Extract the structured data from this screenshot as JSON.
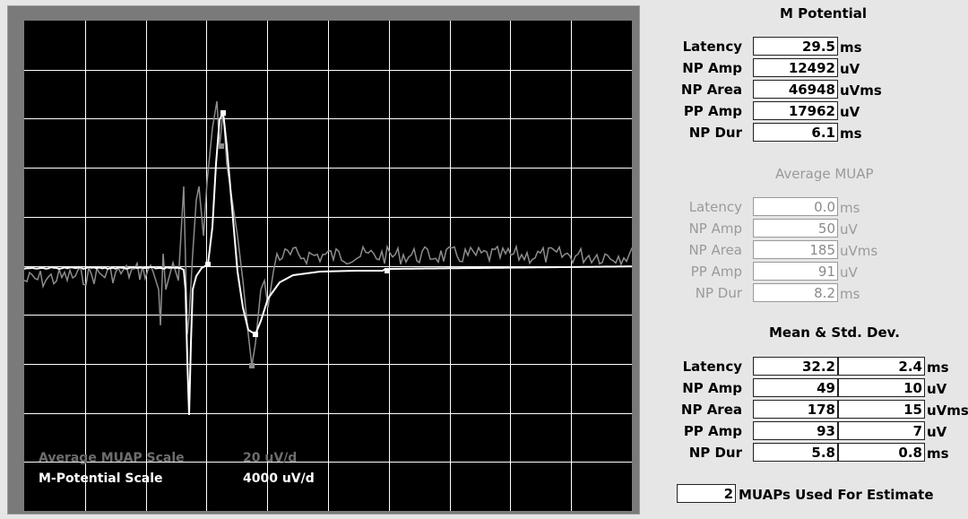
{
  "scope": {
    "avg_muap_scale_label": "Average MUAP Scale",
    "avg_muap_scale_value": "20 uV/d",
    "m_potential_scale_label": "M-Potential Scale",
    "m_potential_scale_value": "4000 uV/d"
  },
  "m_potential": {
    "title": "M Potential",
    "rows": [
      {
        "label": "Latency",
        "value": "29.5",
        "unit": "ms"
      },
      {
        "label": "NP Amp",
        "value": "12492",
        "unit": "uV"
      },
      {
        "label": "NP Area",
        "value": "46948",
        "unit": "uVms"
      },
      {
        "label": "PP Amp",
        "value": "17962",
        "unit": "uV"
      },
      {
        "label": "NP Dur",
        "value": "6.1",
        "unit": "ms"
      }
    ]
  },
  "average_muap": {
    "title": "Average MUAP",
    "rows": [
      {
        "label": "Latency",
        "value": "0.0",
        "unit": "ms"
      },
      {
        "label": "NP Amp",
        "value": "50",
        "unit": "uV"
      },
      {
        "label": "NP Area",
        "value": "185",
        "unit": "uVms"
      },
      {
        "label": "PP Amp",
        "value": "91",
        "unit": "uV"
      },
      {
        "label": "NP Dur",
        "value": "8.2",
        "unit": "ms"
      }
    ]
  },
  "mean_std": {
    "title": "Mean & Std. Dev.",
    "rows": [
      {
        "label": "Latency",
        "mean": "32.2",
        "std": "2.4",
        "unit": "ms"
      },
      {
        "label": "NP Amp",
        "mean": "49",
        "std": "10",
        "unit": "uV"
      },
      {
        "label": "NP Area",
        "mean": "178",
        "std": "15",
        "unit": "uVms"
      },
      {
        "label": "PP Amp",
        "mean": "93",
        "std": "7",
        "unit": "uV"
      },
      {
        "label": "NP Dur",
        "mean": "5.8",
        "std": "0.8",
        "unit": "ms"
      }
    ]
  },
  "estimate": {
    "count": "2",
    "label": "MUAPs Used For Estimate"
  },
  "colors": {
    "scope_bg": "#000000",
    "grid": "#ffffff",
    "m_trace": "#ffffff",
    "muap_trace": "#8c8c8c",
    "panel_bg": "#e6e6e6"
  }
}
